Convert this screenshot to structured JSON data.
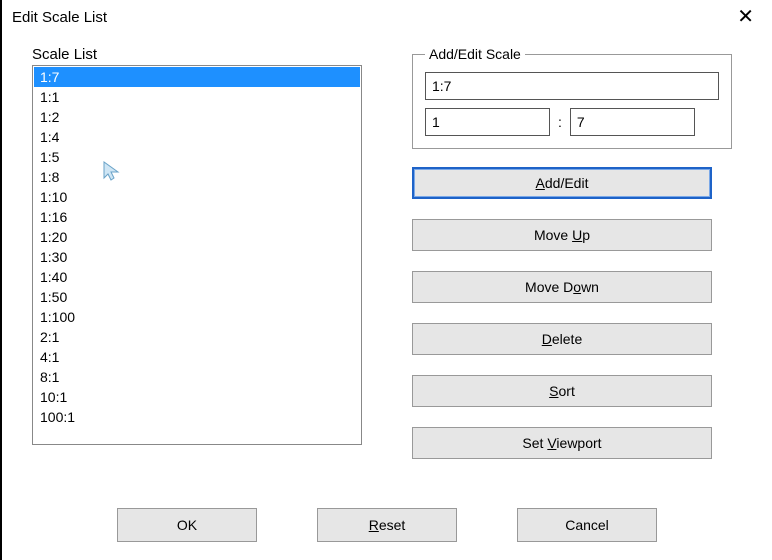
{
  "title": "Edit Scale List",
  "close_glyph": "✕",
  "scale_list": {
    "label": "Scale List",
    "items": [
      "1:7",
      "1:1",
      "1:2",
      "1:4",
      "1:5",
      "1:8",
      "1:10",
      "1:16",
      "1:20",
      "1:30",
      "1:40",
      "1:50",
      "1:100",
      "2:1",
      "4:1",
      "8:1",
      "10:1",
      "100:1"
    ],
    "selected_index": 0
  },
  "add_edit": {
    "legend": "Add/Edit Scale",
    "name_value": "1:7",
    "left_value": "1",
    "separator": ":",
    "right_value": "7"
  },
  "buttons": {
    "add_edit_pre": "",
    "add_edit_u": "A",
    "add_edit_post": "dd/Edit",
    "move_up_pre": "Move ",
    "move_up_u": "U",
    "move_up_post": "p",
    "move_down_pre": "Move D",
    "move_down_u": "o",
    "move_down_post": "wn",
    "delete_pre": "",
    "delete_u": "D",
    "delete_post": "elete",
    "sort_pre": "",
    "sort_u": "S",
    "sort_post": "ort",
    "set_vp_pre": "Set ",
    "set_vp_u": "V",
    "set_vp_post": "iewport",
    "ok": "OK",
    "reset_pre": "",
    "reset_u": "R",
    "reset_post": "eset",
    "cancel": "Cancel"
  }
}
